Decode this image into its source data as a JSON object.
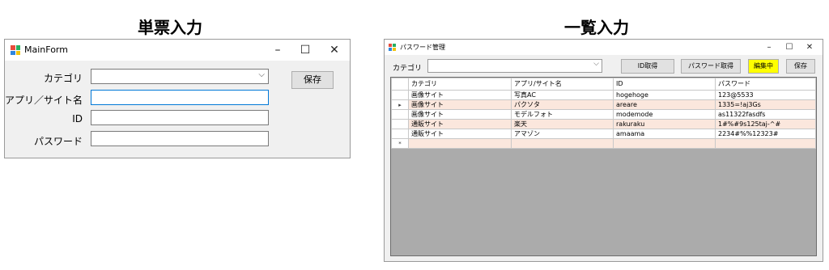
{
  "headings": {
    "left": "単票入力",
    "right": "一覧入力"
  },
  "single_form": {
    "title": "MainForm",
    "controls": {
      "minimize": "–",
      "maximize": "☐",
      "close": "✕"
    },
    "fields": [
      {
        "label": "カテゴリ",
        "value": "",
        "type": "select",
        "dropdown_glyph": "⌵"
      },
      {
        "label": "アプリ／サイト名",
        "value": "",
        "type": "text"
      },
      {
        "label": "ID",
        "value": "",
        "type": "text"
      },
      {
        "label": "パスワード",
        "value": "",
        "type": "text"
      }
    ],
    "save_label": "保存"
  },
  "list_form": {
    "title": "パスワード管理",
    "controls": {
      "minimize": "–",
      "maximize": "☐",
      "close": "✕"
    },
    "category_label": "カテゴリ",
    "category_value": "",
    "dropdown_glyph": "⌵",
    "buttons": {
      "get_id": "ID取得",
      "get_password": "パスワード取得",
      "editing": "編集中",
      "save": "保存"
    },
    "editing_color": "#ffff00",
    "columns": [
      "カテゴリ",
      "アプリ/サイト名",
      "ID",
      "パスワード"
    ],
    "current_row_marker": "▸",
    "new_row_marker": "*",
    "rows": [
      {
        "category": "画像サイト",
        "app": "写真AC",
        "id": "hogehoge",
        "password": "123@5533"
      },
      {
        "category": "画像サイト",
        "app": "パクソタ",
        "id": "areare",
        "password": "1335=!aj3Gs"
      },
      {
        "category": "画像サイト",
        "app": "モデルフォト",
        "id": "modemode",
        "password": "as11322fasdfs"
      },
      {
        "category": "通販サイト",
        "app": "楽天",
        "id": "rakuraku",
        "password": "1#%#9s125taj-^#"
      },
      {
        "category": "通販サイト",
        "app": "アマゾン",
        "id": "amaama",
        "password": "2234#%%12323#"
      }
    ]
  }
}
